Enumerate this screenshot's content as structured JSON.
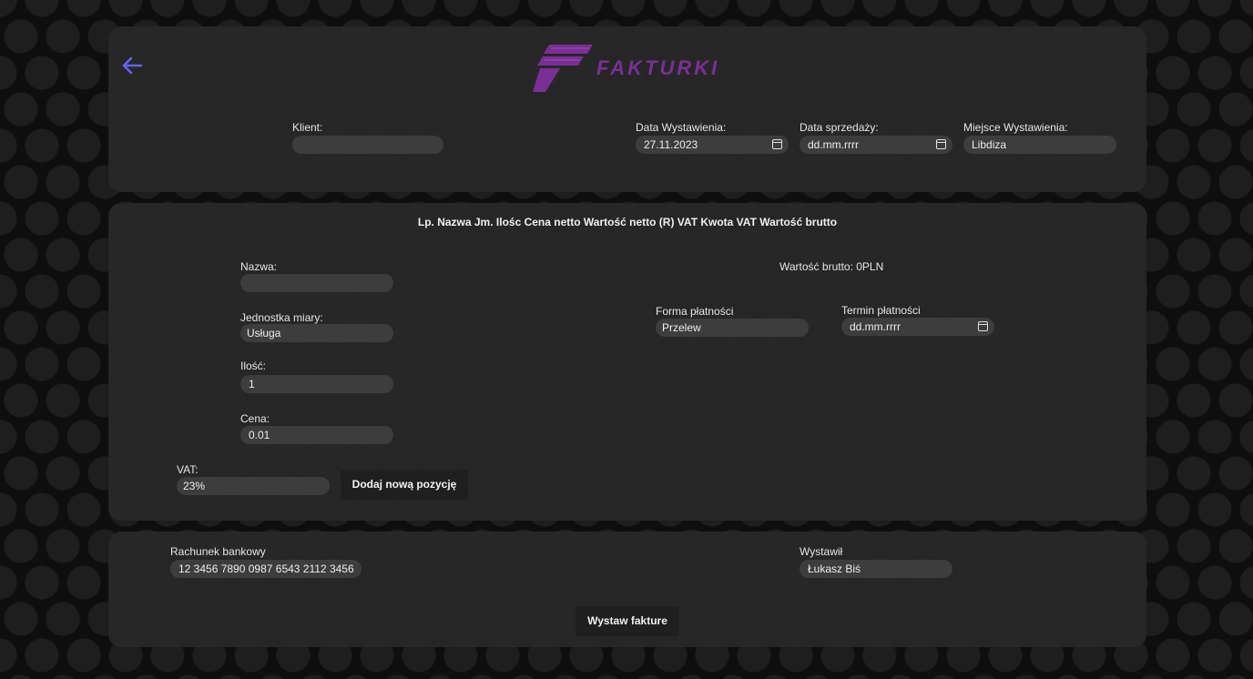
{
  "brand": {
    "name": "FAKTURKI",
    "accent": "#7a2f96",
    "back_arrow_color": "#6464f0"
  },
  "invoice_header": {
    "client_label": "Klient:",
    "client_value": "",
    "issue_date_label": "Data Wystawienia:",
    "issue_date_value": "27.11.2023",
    "sale_date_label": "Data sprzedaży:",
    "sale_date_value": "dd.mm.rrrr",
    "place_label": "Miejsce Wystawienia:",
    "place_value": "Libdiza"
  },
  "items": {
    "table_header": "Lp. Nazwa Jm. Ilośc Cena netto Wartość netto (R) VAT Kwota VAT Wartość brutto",
    "name_label": "Nazwa:",
    "name_value": "",
    "unit_label": "Jednostka miary:",
    "unit_value": "Usługa",
    "qty_label": "Ilość:",
    "qty_value": "1",
    "price_label": "Cena:",
    "price_value": "0.01",
    "vat_label": "VAT:",
    "vat_value": "23%",
    "add_button": "Dodaj nową pozycję",
    "gross_total": "Wartość brutto: 0PLN",
    "payment_form_label": "Forma płatności",
    "payment_form_value": "Przelew",
    "payment_due_label": "Termin płatności",
    "payment_due_value": "dd.mm.rrrr"
  },
  "footer": {
    "bank_label": "Rachunek bankowy",
    "bank_value": "12 3456 7890 0987 6543 2112 3456",
    "issuer_label": "Wystawił",
    "issuer_value": "Łukasz Biś",
    "submit_button": "Wystaw fakture"
  }
}
